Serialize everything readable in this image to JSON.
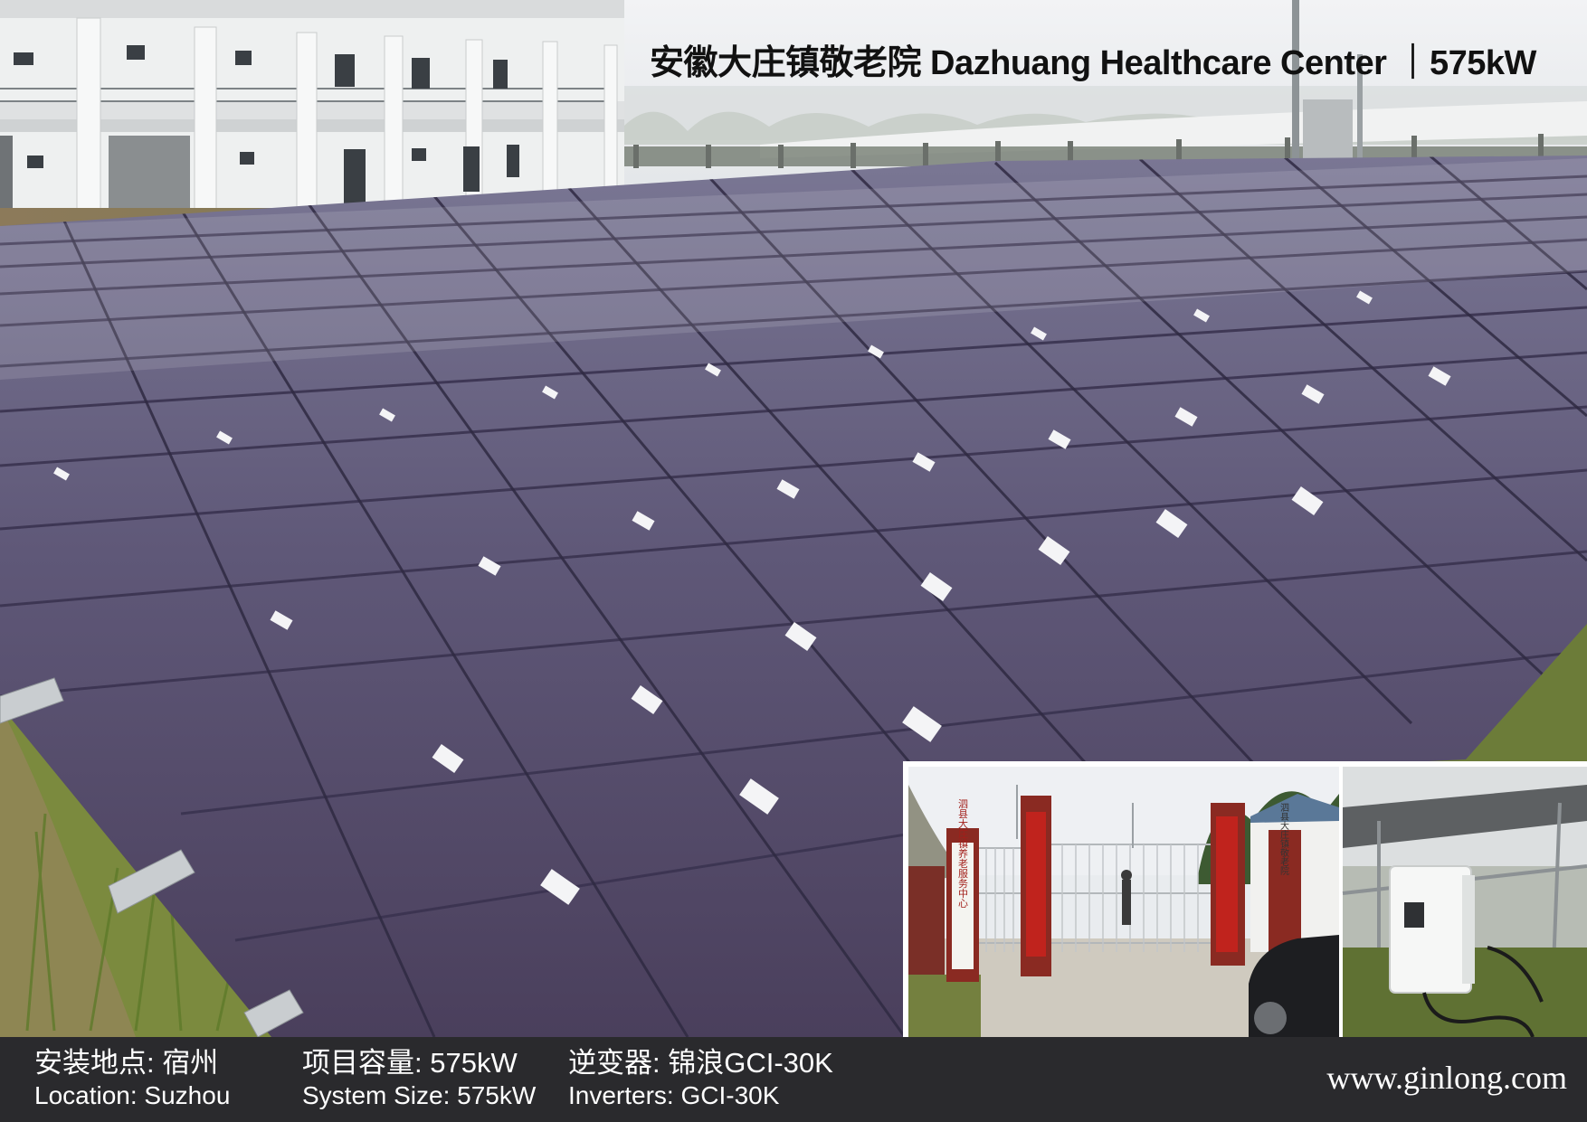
{
  "title": "安徽大庄镇敬老院  Dazhuang Healthcare Center ｜575kW",
  "footer": {
    "location_zh": "安装地点: 宿州",
    "location_en": "Location: Suzhou",
    "size_zh": "项目容量: 575kW",
    "size_en": "System Size: 575kW",
    "inverter_zh": "逆变器: 锦浪GCI-30K",
    "inverter_en": "Inverters: GCI-30K",
    "website": "www.ginlong.com"
  },
  "gate_signs": {
    "left_vertical": "泗县大庄镇养老服务中心",
    "right_vertical": "泗县大庄镇敬老院"
  },
  "colors": {
    "panel": "#58506e",
    "footer_bg": "#2a2a2d",
    "sky": "#e8eaee",
    "sign_red": "#8a2a22"
  }
}
